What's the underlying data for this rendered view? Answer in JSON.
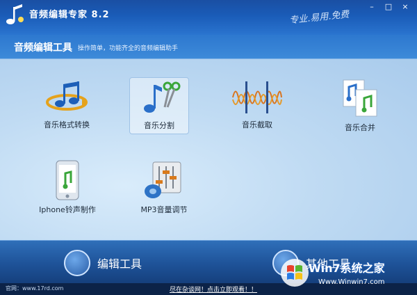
{
  "window": {
    "title": "音频编辑专家 8.2",
    "slogan": "专业.易用.免费",
    "min_glyph": "–",
    "max_glyph": "□",
    "close_glyph": "×"
  },
  "header": {
    "title": "音频编辑工具",
    "subtitle": "操作简单，功能齐全的音频编辑助手"
  },
  "tools": [
    {
      "label": "音乐格式转换",
      "icon": "music-convert-icon"
    },
    {
      "label": "音乐分割",
      "icon": "music-split-icon",
      "selected": true
    },
    {
      "label": "音乐截取",
      "icon": "music-cut-icon"
    },
    {
      "label": "音乐合并",
      "icon": "music-merge-icon"
    },
    {
      "label": "Iphone铃声制作",
      "icon": "iphone-ringtone-icon"
    },
    {
      "label": "MP3音量调节",
      "icon": "mp3-volume-icon"
    }
  ],
  "footer": {
    "edit_tools": "编辑工具",
    "other_tools": "其他工具"
  },
  "status": {
    "website": "官网：www.17rd.com",
    "promo": "尽在杂谈网！点击立即观看！！"
  },
  "watermark": {
    "brand": "Win7系统之家",
    "url": "Www.Winwin7.com"
  },
  "colors": {
    "titlebar": "#1a5cb8",
    "panel": "#c0dbf3",
    "footer": "#1e5298"
  }
}
